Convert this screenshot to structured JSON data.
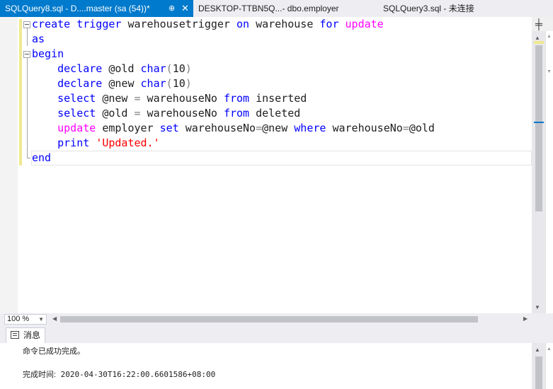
{
  "tabs": [
    {
      "label": "SQLQuery8.sql - D....master (sa (54))*",
      "pin": "⊕",
      "close": "✕",
      "active": true
    },
    {
      "label": "DESKTOP-TTBN5Q...- dbo.employer",
      "active": false
    },
    {
      "label": "SQLQuery3.sql - 未连接",
      "active": false
    }
  ],
  "editor": {
    "lines": [
      [
        {
          "t": "create",
          "c": "kw"
        },
        {
          "t": " "
        },
        {
          "t": "trigger",
          "c": "kw"
        },
        {
          "t": " warehousetrigger "
        },
        {
          "t": "on",
          "c": "kw"
        },
        {
          "t": " warehouse "
        },
        {
          "t": "for",
          "c": "kw"
        },
        {
          "t": " "
        },
        {
          "t": "update",
          "c": "fn"
        }
      ],
      [
        {
          "t": "as",
          "c": "kw"
        }
      ],
      [
        {
          "t": "begin",
          "c": "kw"
        }
      ],
      [
        {
          "t": "    "
        },
        {
          "t": "declare",
          "c": "kw"
        },
        {
          "t": " @old "
        },
        {
          "t": "char",
          "c": "kw"
        },
        {
          "t": "(",
          "c": "gray"
        },
        {
          "t": "10"
        },
        {
          "t": ")",
          "c": "gray"
        }
      ],
      [
        {
          "t": "    "
        },
        {
          "t": "declare",
          "c": "kw"
        },
        {
          "t": " @new "
        },
        {
          "t": "char",
          "c": "kw"
        },
        {
          "t": "(",
          "c": "gray"
        },
        {
          "t": "10"
        },
        {
          "t": ")",
          "c": "gray"
        }
      ],
      [
        {
          "t": "    "
        },
        {
          "t": "select",
          "c": "kw"
        },
        {
          "t": " @new "
        },
        {
          "t": "=",
          "c": "gray"
        },
        {
          "t": " warehouseNo "
        },
        {
          "t": "from",
          "c": "kw"
        },
        {
          "t": " inserted"
        }
      ],
      [
        {
          "t": "    "
        },
        {
          "t": "select",
          "c": "kw"
        },
        {
          "t": " @old "
        },
        {
          "t": "=",
          "c": "gray"
        },
        {
          "t": " warehouseNo "
        },
        {
          "t": "from",
          "c": "kw"
        },
        {
          "t": " deleted"
        }
      ],
      [
        {
          "t": "    "
        },
        {
          "t": "update",
          "c": "fn"
        },
        {
          "t": " employer "
        },
        {
          "t": "set",
          "c": "kw"
        },
        {
          "t": " warehouseNo"
        },
        {
          "t": "=",
          "c": "gray"
        },
        {
          "t": "@new "
        },
        {
          "t": "where",
          "c": "kw"
        },
        {
          "t": " warehouseNo"
        },
        {
          "t": "=",
          "c": "gray"
        },
        {
          "t": "@old"
        }
      ],
      [
        {
          "t": "    "
        },
        {
          "t": "print",
          "c": "kw"
        },
        {
          "t": " "
        },
        {
          "t": "'Updated.'",
          "c": "str"
        }
      ],
      [
        {
          "t": "end",
          "c": "kw"
        }
      ]
    ],
    "split_icon": "╪"
  },
  "zoom": {
    "value": "100 %"
  },
  "messages": {
    "tab_label": "消息",
    "line1": "命令已成功完成。",
    "line2_label": "完成时间:",
    "line2_value": " 2020-04-30T16:22:00.6601586+08:00"
  },
  "colors": {
    "accent": "#007acc",
    "keyword": "#0000ff",
    "function": "#ff00ff",
    "string": "#ff0000",
    "operator": "#808080",
    "changed_marker": "#efe98f"
  }
}
